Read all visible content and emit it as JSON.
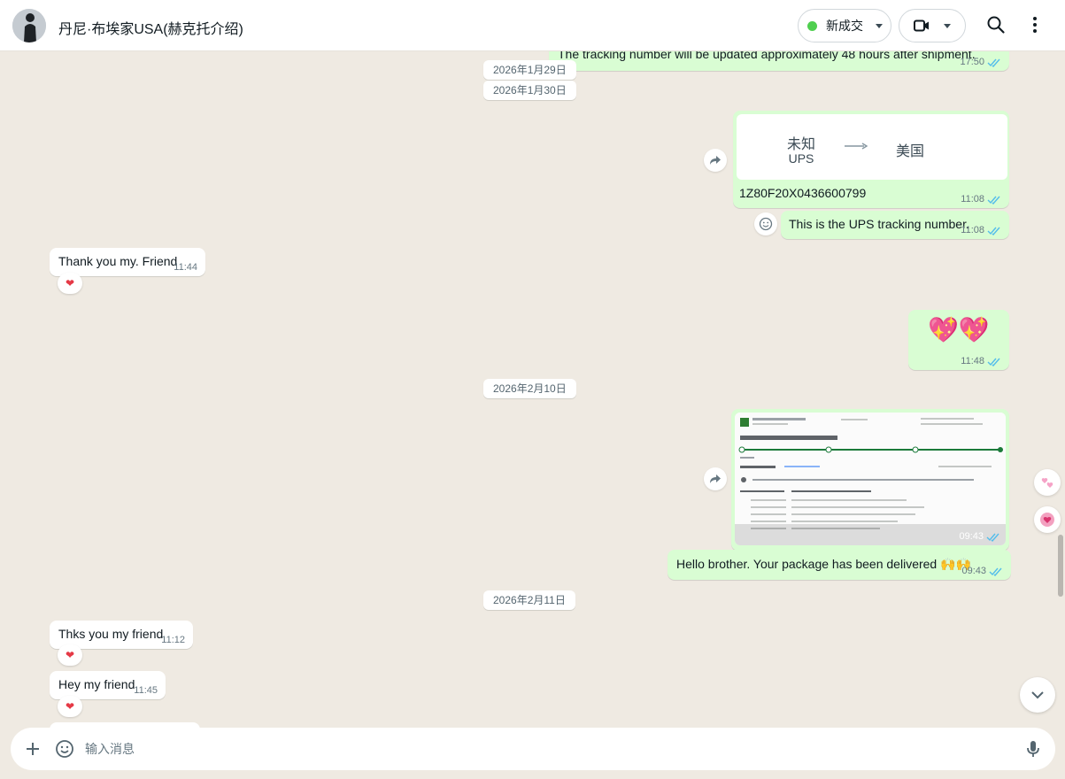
{
  "header": {
    "contact_name": "丹尼·布埃家USA(赫克托介绍)",
    "label_pill": "新成交",
    "icons": [
      "avatar",
      "video-call-icon",
      "search-icon",
      "more-vert-icon"
    ]
  },
  "dates": [
    "2026年1月29日",
    "2026年1月30日",
    "2026年2月10日",
    "2026年2月11日"
  ],
  "messages": {
    "shipment_note": {
      "text": "The tracking number will be updated approximately 48 hours after shipment.",
      "time": "17:50"
    },
    "tracking_card": {
      "origin": "未知",
      "carrier": "UPS",
      "destination": "美国",
      "number": "1Z80F20X0436600799",
      "time": "11:08"
    },
    "ups_note": {
      "text": "This is the UPS tracking number.",
      "time": "11:08"
    },
    "thanks_friend": {
      "text": "Thank you my. Friend",
      "time": "11:44",
      "reaction": "❤"
    },
    "hearts": {
      "text": "💖💖",
      "time": "11:48"
    },
    "delivered_screenshot": {
      "time": "09:43"
    },
    "delivered_text": {
      "text": "Hello brother. Your package has been delivered 🙌🙌",
      "time": "09:43"
    },
    "thks_friend": {
      "text": "Thks you my friend",
      "time": "11:12",
      "reaction": "❤"
    },
    "hey_friend": {
      "text": "Hey my friend",
      "time": "11:45",
      "reaction": "❤"
    }
  },
  "composer": {
    "placeholder": "输入消息"
  },
  "colors": {
    "outgoing": "#d9fdd3",
    "incoming": "#ffffff",
    "background": "#efeae2",
    "tick": "#53bdeb"
  }
}
